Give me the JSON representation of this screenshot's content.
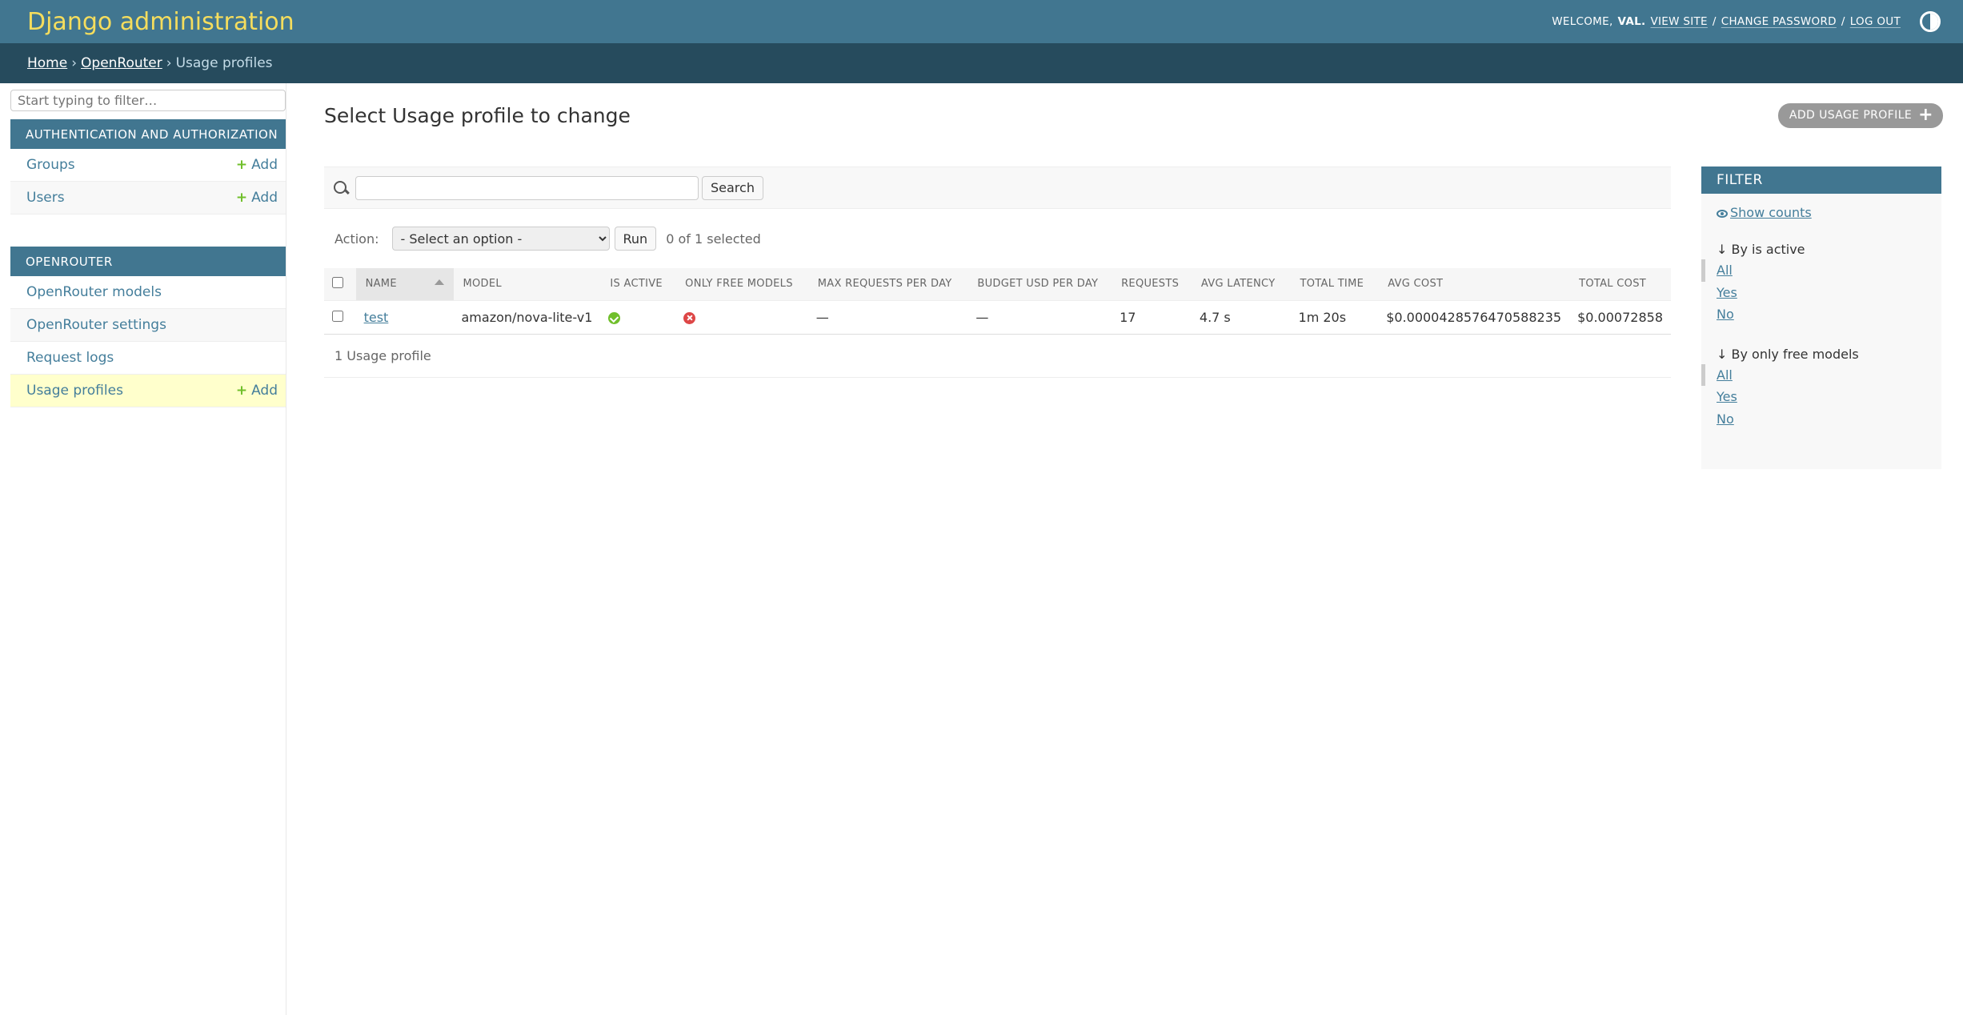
{
  "header": {
    "site_name": "Django administration",
    "welcome": "WELCOME,",
    "username": "VAL.",
    "view_site": "VIEW SITE",
    "change_password": "CHANGE PASSWORD",
    "log_out": "LOG OUT",
    "sep": "/"
  },
  "breadcrumbs": {
    "home": "Home",
    "app": "OpenRouter",
    "current": "Usage profiles",
    "sep": "›"
  },
  "sidebar": {
    "filter_placeholder": "Start typing to filter…",
    "modules": [
      {
        "title": "Authentication and Authorization",
        "items": [
          {
            "label": "Groups",
            "add": "Add"
          },
          {
            "label": "Users",
            "add": "Add"
          }
        ]
      },
      {
        "title": "OpenRouter",
        "items": [
          {
            "label": "OpenRouter models"
          },
          {
            "label": "OpenRouter settings"
          },
          {
            "label": "Request logs"
          },
          {
            "label": "Usage profiles",
            "add": "Add"
          }
        ]
      }
    ],
    "collapse_glyph": "«"
  },
  "content": {
    "title": "Select Usage profile to change",
    "add_button": "ADD USAGE PROFILE",
    "search_button": "Search",
    "action_label": "Action:",
    "action_select": "- Select an option -",
    "run_button": "Run",
    "selected_counter": "0 of 1 selected",
    "columns": [
      "Name",
      "Model",
      "Is active",
      "Only free models",
      "Max requests per day",
      "Budget USD per day",
      "Requests",
      "Avg latency",
      "Total time",
      "Avg cost",
      "Total cost"
    ],
    "rows": [
      {
        "name": "test",
        "model": "amazon/nova-lite-v1",
        "is_active": true,
        "only_free_models": false,
        "max_requests_per_day": "—",
        "budget_usd_per_day": "—",
        "requests": "17",
        "avg_latency": "4.7 s",
        "total_time": "1m 20s",
        "avg_cost": "$0.0000428576470588235",
        "total_cost": "$0.00072858"
      }
    ],
    "paginator": "1 Usage profile"
  },
  "filter": {
    "title": "Filter",
    "show_counts": "Show counts",
    "groups": [
      {
        "title": "↓ By is active",
        "options": [
          "All",
          "Yes",
          "No"
        ],
        "selected": "All"
      },
      {
        "title": "↓ By only free models",
        "options": [
          "All",
          "Yes",
          "No"
        ],
        "selected": "All"
      }
    ]
  },
  "colors": {
    "header_bg": "#417690",
    "breadcrumbs_bg": "#264b5d",
    "site_name": "#f5dd5d",
    "link": "#447e9b",
    "add_green": "#70bf2b",
    "current_row": "#ffffcc"
  }
}
